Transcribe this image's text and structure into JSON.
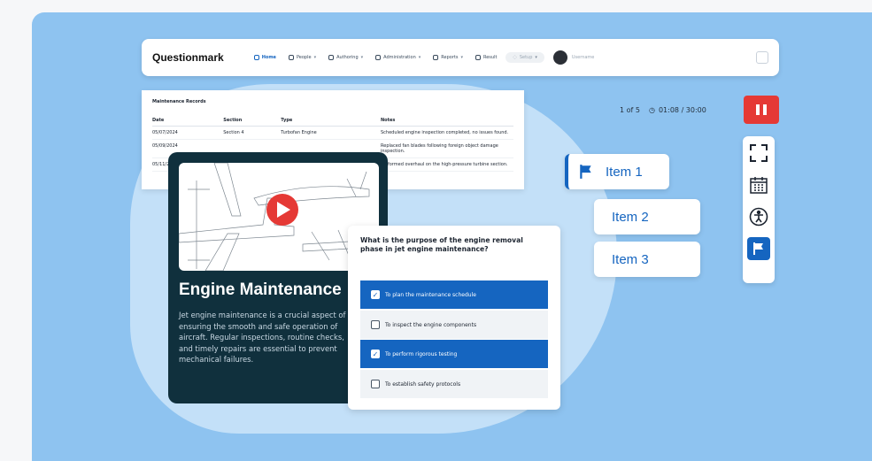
{
  "app": {
    "logo": "Questionmark",
    "nav": [
      {
        "label": "Home",
        "active": true
      },
      {
        "label": "People"
      },
      {
        "label": "Authoring"
      },
      {
        "label": "Administration"
      },
      {
        "label": "Reports"
      },
      {
        "label": "Result"
      }
    ],
    "search_label": "Setup",
    "user_name": "Username"
  },
  "table": {
    "title": "Maintenance Records",
    "headers": [
      "Date",
      "Section",
      "Type",
      "Notes"
    ],
    "rows": [
      [
        "05/07/2024",
        "Section 4",
        "Turbofan Engine",
        "Scheduled engine inspection completed, no issues found."
      ],
      [
        "05/09/2024",
        "",
        "",
        "Replaced fan blades following foreign object damage inspection."
      ],
      [
        "05/11/2024",
        "",
        "",
        "Performed overhaul on the high-pressure turbine section."
      ]
    ]
  },
  "timer": {
    "position": "1 of 5",
    "time": "01:08 / 30:00"
  },
  "items": [
    "Item 1",
    "Item 2",
    "Item 3"
  ],
  "tools": [
    "fullscreen-icon",
    "calendar-icon",
    "accessibility-icon",
    "flag-icon"
  ],
  "video": {
    "title": "Engine Maintenance",
    "body": "Jet engine maintenance is a crucial aspect of ensuring the smooth and safe operation of aircraft. Regular inspections, routine checks, and timely repairs are essential to prevent mechanical failures."
  },
  "question": {
    "text": "What is the purpose of the engine removal phase in jet engine maintenance?",
    "options": [
      {
        "label": "To plan the maintenance schedule",
        "selected": true
      },
      {
        "label": "To inspect the engine components",
        "selected": false
      },
      {
        "label": "To perform rigorous testing",
        "selected": true
      },
      {
        "label": "To establish safety protocols",
        "selected": false
      }
    ]
  },
  "colors": {
    "accent": "#1565c0",
    "pause": "#e53935",
    "panel": "#8ec3f0",
    "card_dark": "#10303d"
  }
}
